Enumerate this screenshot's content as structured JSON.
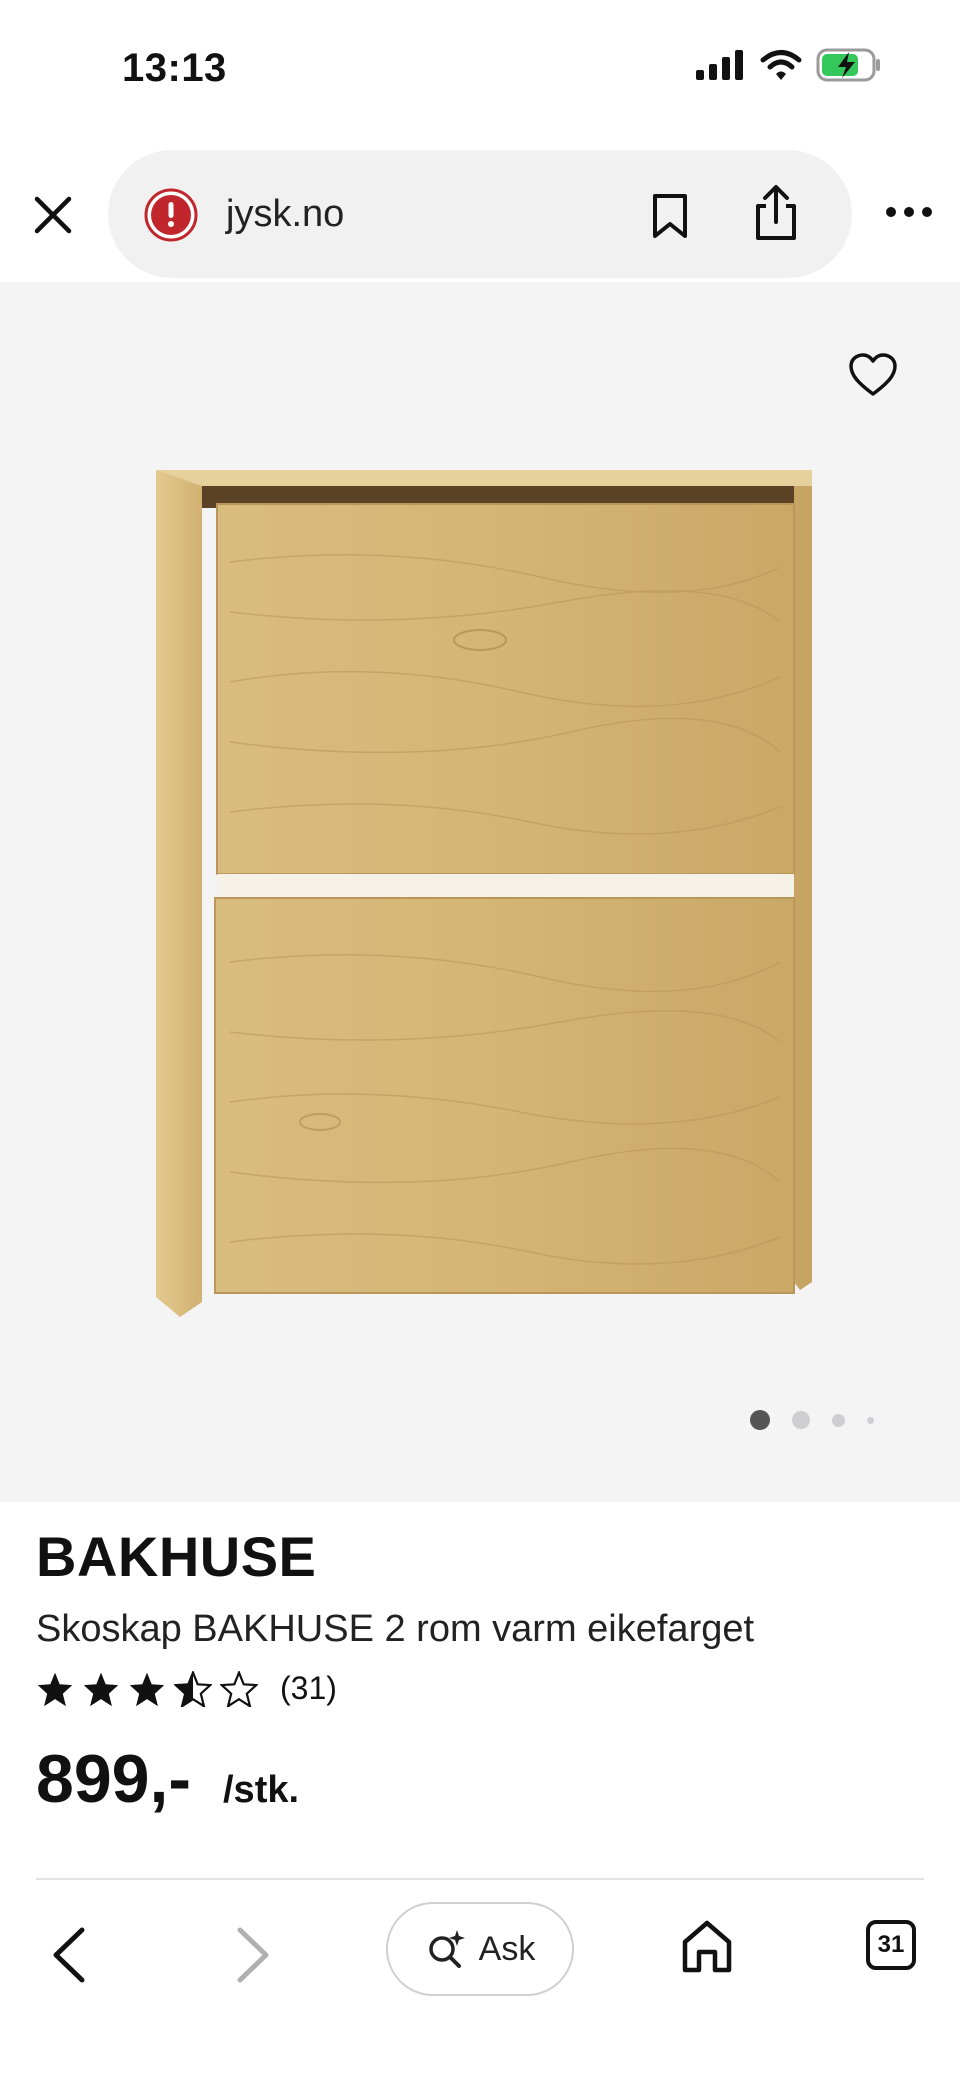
{
  "status_bar": {
    "time": "13:13",
    "icons": [
      "signal-icon",
      "wifi-icon",
      "battery-charging-icon"
    ]
  },
  "browser": {
    "url": "jysk.no",
    "security_icon": "warning-icon",
    "close_icon": "close-icon",
    "bookmark_icon": "bookmark-icon",
    "share_icon": "share-icon",
    "more_icon": "more-icon"
  },
  "gallery": {
    "favorite_icon": "heart-icon",
    "image_count": 4,
    "active_index": 0,
    "background": "#f4f4f5"
  },
  "product": {
    "brand": "BAKHUSE",
    "title": "Skoskap BAKHUSE 2 rom varm eikefarget",
    "rating": 3.5,
    "rating_max": 5,
    "review_count": "(31)",
    "price": "899,-",
    "unit": "/stk."
  },
  "toolbar": {
    "back_icon": "chevron-left-icon",
    "forward_icon": "chevron-right-icon",
    "ask_label": "Ask",
    "ask_icon": "search-sparkle-icon",
    "home_icon": "home-icon",
    "tabs_count": "31"
  }
}
